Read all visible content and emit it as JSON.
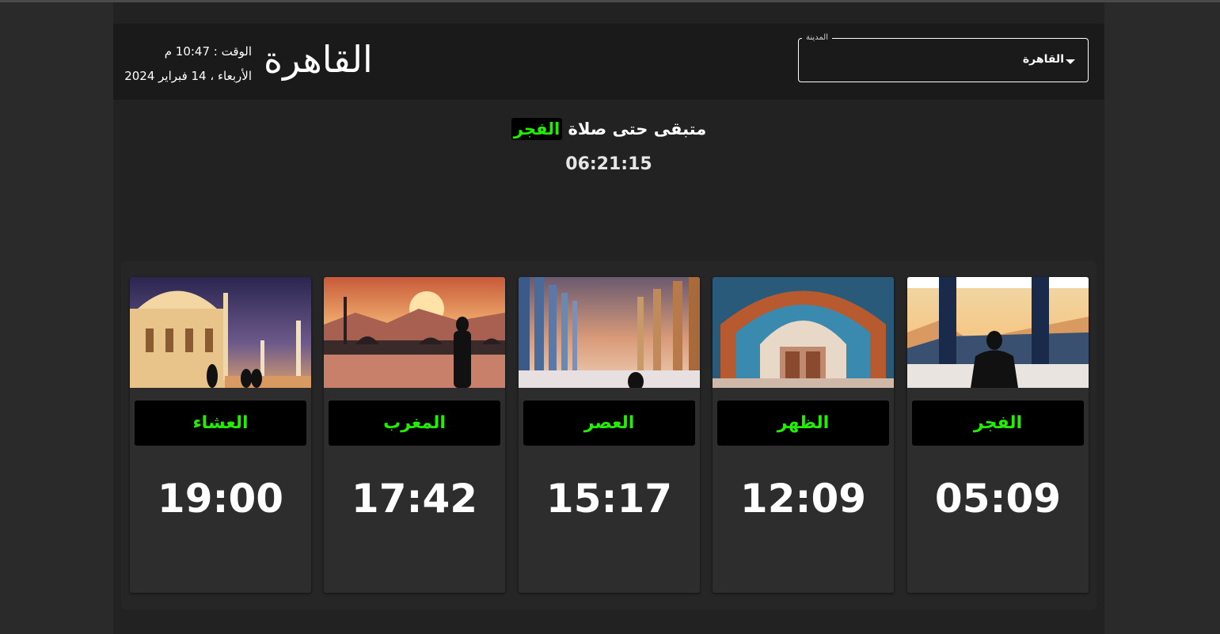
{
  "header": {
    "city_select_label": "المدينة",
    "city_select_value": "القاهرة",
    "city_title": "القاهرة",
    "time_line": "الوقت : 10:47 م",
    "date_line": "الأربعاء ، 14 فبراير 2024"
  },
  "countdown": {
    "prefix": "متبقى حتى صلاة",
    "next_prayer": "الفجر",
    "remaining": "06:21:15"
  },
  "prayers": [
    {
      "name": "العشاء",
      "time": "19:00",
      "image": "mosque-night-icon"
    },
    {
      "name": "المغرب",
      "time": "17:42",
      "image": "sunset-reflection-icon"
    },
    {
      "name": "العصر",
      "time": "15:17",
      "image": "arched-colonnade-icon"
    },
    {
      "name": "الظهر",
      "time": "12:09",
      "image": "mosque-archway-icon"
    },
    {
      "name": "الفجر",
      "time": "05:09",
      "image": "dawn-mountains-icon"
    }
  ],
  "colors": {
    "accent_green": "#22ee00",
    "background": "#2a2a2a",
    "header_bg": "#1a1a1a",
    "card_bg": "#2d2d2d"
  }
}
